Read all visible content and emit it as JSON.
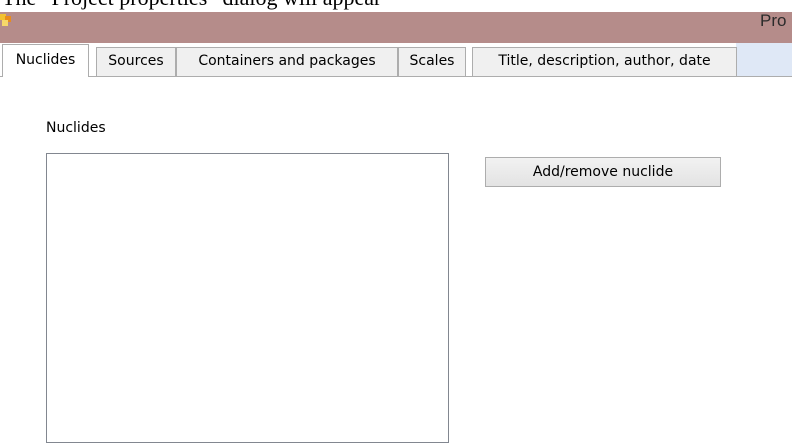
{
  "caption": {
    "text": "The “Project properties” dialog will appear"
  },
  "window": {
    "title": "Pro"
  },
  "tabs": [
    {
      "label": "Nuclides",
      "active": true
    },
    {
      "label": "Sources",
      "active": false
    },
    {
      "label": "Containers and packages",
      "active": false
    },
    {
      "label": "Scales",
      "active": false
    },
    {
      "label": "Title, description, author, date",
      "active": false
    }
  ],
  "nuclides_panel": {
    "section_label": "Nuclides",
    "nuclide_list": [],
    "add_remove_button_label": "Add/remove nuclide"
  },
  "colors": {
    "titlebar": "#b58c8a",
    "tabstrip_fill": "#dfe8f6",
    "button_face": "#e8e8e8"
  },
  "icons": {
    "app": "application-icon"
  }
}
